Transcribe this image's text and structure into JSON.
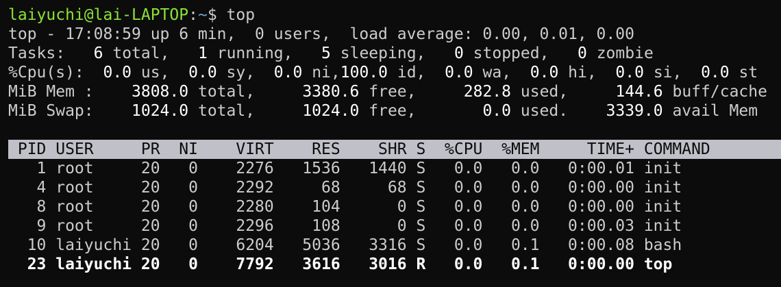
{
  "prompt": {
    "user_host": "laiyuchi@lai-LAPTOP",
    "colon": ":",
    "path": "~",
    "symbol": "$",
    "command": "top"
  },
  "summary": {
    "line1": "top - 17:08:59 up 6 min,  0 users,  load average: 0.00, 0.01, 0.00",
    "tasks": {
      "label": "Tasks:",
      "total": "6",
      "total_label": "total,",
      "running": "1",
      "running_label": "running,",
      "sleeping": "5",
      "sleeping_label": "sleeping,",
      "stopped": "0",
      "stopped_label": "stopped,",
      "zombie": "0",
      "zombie_label": "zombie"
    },
    "cpu": {
      "label": "%Cpu(s):",
      "us": "0.0",
      "us_label": "us,",
      "sy": "0.0",
      "sy_label": "sy,",
      "ni": "0.0",
      "ni_label": "ni,",
      "id": "100.0",
      "id_label": "id,",
      "wa": "0.0",
      "wa_label": "wa,",
      "hi": "0.0",
      "hi_label": "hi,",
      "si": "0.0",
      "si_label": "si,",
      "st": "0.0",
      "st_label": "st"
    },
    "mem": {
      "label": "MiB Mem :",
      "total": "3808.0",
      "total_label": "total,",
      "free": "3380.6",
      "free_label": "free,",
      "used": "282.8",
      "used_label": "used,",
      "buff": "144.6",
      "buff_label": "buff/cache"
    },
    "swap": {
      "label": "MiB Swap:",
      "total": "1024.0",
      "total_label": "total,",
      "free": "1024.0",
      "free_label": "free,",
      "used": "0.0",
      "used_label": "used.",
      "avail": "3339.0",
      "avail_label": "avail Mem"
    }
  },
  "table": {
    "headers": [
      "PID",
      "USER",
      "PR",
      "NI",
      "VIRT",
      "RES",
      "SHR",
      "S",
      "%CPU",
      "%MEM",
      "TIME+",
      "COMMAND"
    ],
    "rows": [
      [
        "1",
        "root",
        "20",
        "0",
        "2276",
        "1536",
        "1440",
        "S",
        "0.0",
        "0.0",
        "0:00.01",
        "init"
      ],
      [
        "4",
        "root",
        "20",
        "0",
        "2292",
        "68",
        "68",
        "S",
        "0.0",
        "0.0",
        "0:00.00",
        "init"
      ],
      [
        "8",
        "root",
        "20",
        "0",
        "2280",
        "104",
        "0",
        "S",
        "0.0",
        "0.0",
        "0:00.00",
        "init"
      ],
      [
        "9",
        "root",
        "20",
        "0",
        "2296",
        "108",
        "0",
        "S",
        "0.0",
        "0.0",
        "0:00.03",
        "init"
      ],
      [
        "10",
        "laiyuchi",
        "20",
        "0",
        "6204",
        "5036",
        "3316",
        "S",
        "0.0",
        "0.1",
        "0:00.08",
        "bash"
      ],
      [
        "23",
        "laiyuchi",
        "20",
        "0",
        "7792",
        "3616",
        "3016",
        "R",
        "0.0",
        "0.1",
        "0:00.00",
        "top"
      ]
    ]
  },
  "colors": {
    "background": "#0c0c0c",
    "text": "#cccccc",
    "highlight": "#ffffff",
    "prompt_user": "#8ae234",
    "prompt_path": "#729fcf",
    "header_bg": "#c0c0c8",
    "header_fg": "#0c0c0c"
  }
}
